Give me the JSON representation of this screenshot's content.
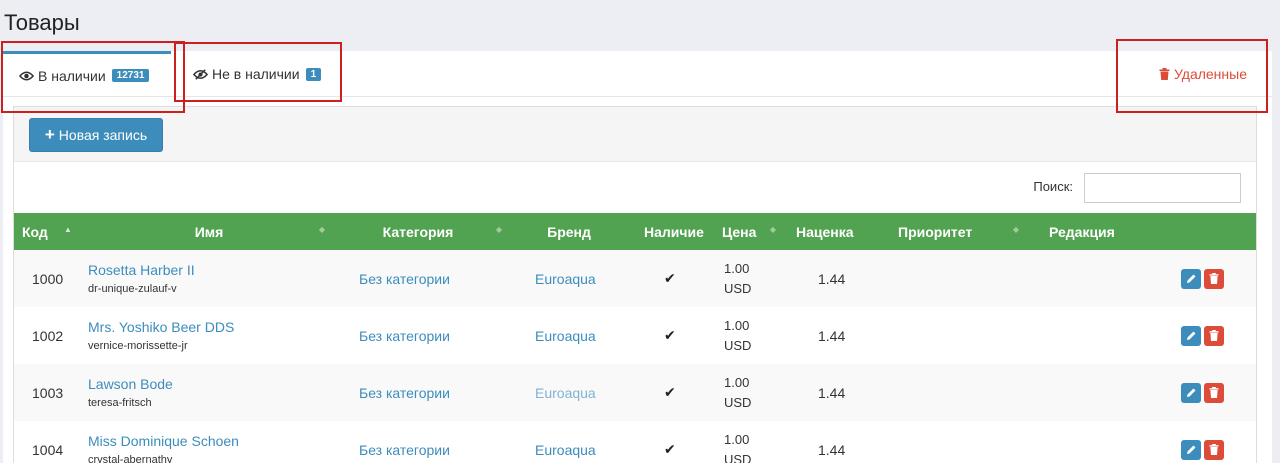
{
  "page": {
    "title": "Товары"
  },
  "tabs": {
    "in_stock": {
      "label": "В наличии",
      "count": "12731"
    },
    "out_of_stock": {
      "label": "Не в наличии",
      "count": "1"
    },
    "deleted": {
      "label": "Удаленные"
    }
  },
  "toolbar": {
    "new_record_label": "Новая запись"
  },
  "search": {
    "label": "Поиск:",
    "value": "",
    "placeholder": ""
  },
  "table": {
    "columns": [
      "Код",
      "Имя",
      "Категория",
      "Бренд",
      "Наличие",
      "Цена",
      "Наценка",
      "Приоритет",
      "Редакция"
    ],
    "rows": [
      {
        "code": "1000",
        "name": "Rosetta Harber II",
        "slug": "dr-unique-zulauf-v",
        "category": "Без категории",
        "brand": "Euroaqua",
        "in_stock": "✔",
        "price": "1.00",
        "currency": "USD",
        "markup": "1.44"
      },
      {
        "code": "1002",
        "name": "Mrs. Yoshiko Beer DDS",
        "slug": "vernice-morissette-jr",
        "category": "Без категории",
        "brand": "Euroaqua",
        "in_stock": "✔",
        "price": "1.00",
        "currency": "USD",
        "markup": "1.44"
      },
      {
        "code": "1003",
        "name": "Lawson Bode",
        "slug": "teresa-fritsch",
        "category": "Без категории",
        "brand": "Euroaqua",
        "in_stock": "✔",
        "price": "1.00",
        "currency": "USD",
        "markup": "1.44"
      },
      {
        "code": "1004",
        "name": "Miss Dominique Schoen",
        "slug": "crystal-abernathy",
        "category": "Без категории",
        "brand": "Euroaqua",
        "in_stock": "✔",
        "price": "1.00",
        "currency": "USD",
        "markup": "1.44"
      }
    ]
  },
  "icons": {
    "tab_in_stock": "eye-icon",
    "tab_out_of_stock": "eye-slash-icon",
    "tab_deleted": "trash-icon",
    "new_record": "plus-icon",
    "edit": "pencil-icon",
    "delete": "trash-icon"
  },
  "colors": {
    "accent": "#3c8dbc",
    "table_header": "#51a351",
    "danger": "#dd4b39",
    "highlight_box": "#cc1f1f"
  }
}
